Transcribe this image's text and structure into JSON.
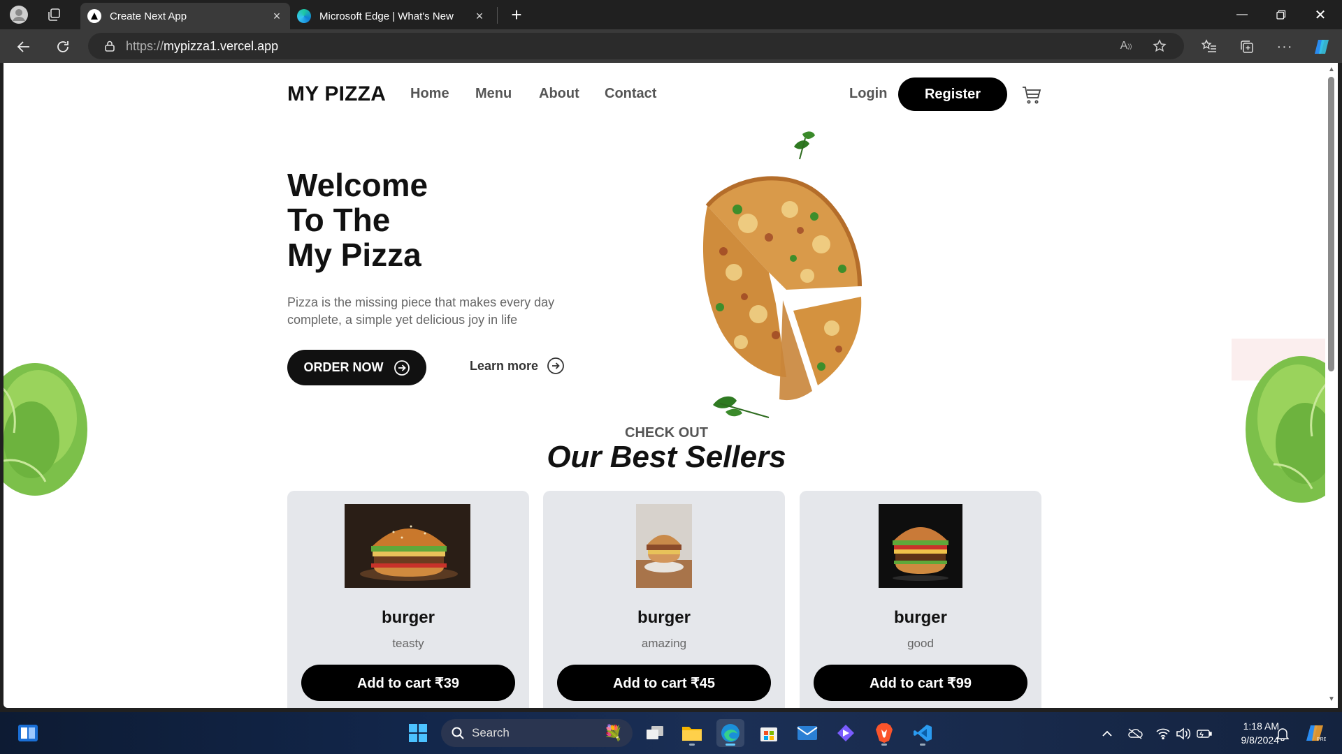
{
  "browser": {
    "tabs": [
      {
        "label": "Create Next App",
        "active": true
      },
      {
        "label": "Microsoft Edge | What's New",
        "active": false
      }
    ],
    "url_scheme": "https://",
    "url_host": "mypizza1.vercel.app"
  },
  "site": {
    "logo": "MY PIZZA",
    "nav": [
      "Home",
      "Menu",
      "About",
      "Contact"
    ],
    "login": "Login",
    "register": "Register",
    "hero": {
      "title_lines": [
        "Welcome",
        "To The",
        "My Pizza"
      ],
      "subtitle": "Pizza is the missing piece that makes every day complete, a simple yet delicious joy in life",
      "order_now": "ORDER NOW",
      "learn_more": "Learn more"
    },
    "section_kicker": "CHECK OUT",
    "section_title": "Our Best Sellers",
    "products": [
      {
        "name": "burger",
        "desc": "teasty",
        "button": "Add to cart ₹39"
      },
      {
        "name": "burger",
        "desc": "amazing",
        "button": "Add to cart ₹45"
      },
      {
        "name": "burger",
        "desc": "good",
        "button": "Add to cart ₹99"
      }
    ]
  },
  "taskbar": {
    "search_label": "Search",
    "time": "1:18 AM",
    "date": "9/8/2024"
  }
}
